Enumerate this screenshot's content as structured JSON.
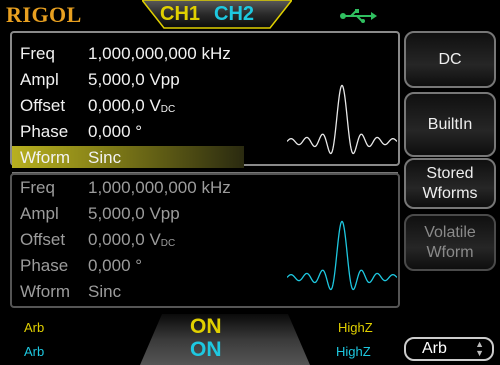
{
  "header": {
    "logo": "RIGOL",
    "tabs": [
      {
        "label": "CH1"
      },
      {
        "label": "CH2"
      }
    ]
  },
  "channel1": {
    "params": [
      {
        "label": "Freq",
        "value": "1,000,000,000 kHz"
      },
      {
        "label": "Ampl",
        "value": "5,000,0 Vpp"
      },
      {
        "label": "Offset",
        "value": "0,000,0 V",
        "unit_sub": "DC"
      },
      {
        "label": "Phase",
        "value": "0,000 °"
      },
      {
        "label": "Wform",
        "value": "Sinc"
      }
    ]
  },
  "channel2": {
    "params": [
      {
        "label": "Freq",
        "value": "1,000,000,000 kHz"
      },
      {
        "label": "Ampl",
        "value": "5,000,0 Vpp"
      },
      {
        "label": "Offset",
        "value": "0,000,0 V",
        "unit_sub": "DC"
      },
      {
        "label": "Phase",
        "value": "0,000 °"
      },
      {
        "label": "Wform",
        "value": "Sinc"
      }
    ]
  },
  "softkeys": {
    "dc": "DC",
    "builtin": "BuiltIn",
    "stored_line1": "Stored",
    "stored_line2": "Wforms",
    "volatile_line1": "Volatile",
    "volatile_line2": "Wform"
  },
  "status": {
    "ch1_mode": "Arb",
    "ch2_mode": "Arb",
    "ch1_output": "ON",
    "ch2_output": "ON",
    "ch1_load": "HighZ",
    "ch2_load": "HighZ"
  },
  "arb_selector": "Arb",
  "colors": {
    "ch1": "#e0d000",
    "ch2": "#1ec8e0",
    "logo": "#e8a020"
  }
}
